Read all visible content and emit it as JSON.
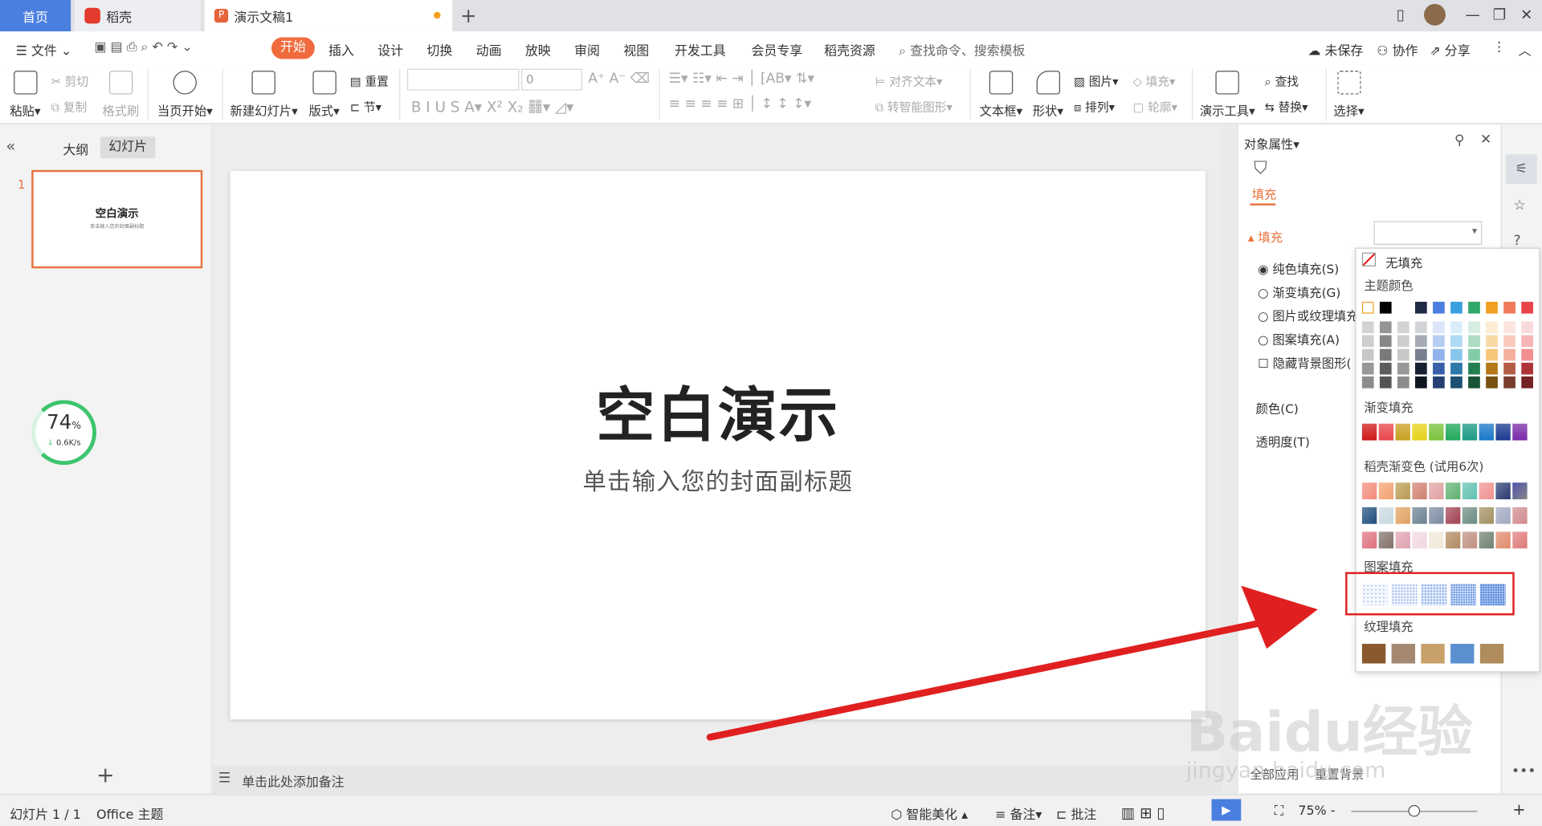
{
  "tabs": {
    "home": "首页",
    "daoke": "稻壳",
    "doc": "演示文稿1"
  },
  "menu": {
    "file": "文件",
    "start": "开始",
    "insert": "插入",
    "design": "设计",
    "switch": "切换",
    "animation": "动画",
    "play": "放映",
    "review": "审阅",
    "view": "视图",
    "dev": "开发工具",
    "vip": "会员专享",
    "resources": "稻壳资源",
    "search": "查找命令、搜索模板",
    "unsaved": "未保存",
    "collab": "协作",
    "share": "分享"
  },
  "ribbon": {
    "paste": "粘贴",
    "cut": "剪切",
    "copy": "复制",
    "format_brush": "格式刷",
    "from_current": "当页开始",
    "new_slide": "新建幻灯片",
    "layout": "版式",
    "section": "节",
    "reset": "重置",
    "font_size": "0",
    "align_text": "对齐文本",
    "smartart": "转智能图形",
    "textbox": "文本框",
    "shape": "形状",
    "picture": "图片",
    "arrange": "排列",
    "fill": "填充",
    "outline": "轮廓",
    "present_tool": "演示工具",
    "find": "查找",
    "replace": "替换",
    "select": "选择"
  },
  "left": {
    "outline_tab": "大纲",
    "slides_tab": "幻灯片",
    "slide_number": "1",
    "thumb_title": "空白演示",
    "thumb_sub": "单击输入您的封面副标题",
    "progress_value": "74",
    "progress_unit": "%",
    "net_speed": "0.6K/s"
  },
  "slide": {
    "title": "空白演示",
    "subtitle": "单击输入您的封面副标题"
  },
  "notes": {
    "placeholder": "单击此处添加备注"
  },
  "panel": {
    "title": "对象属性",
    "fill_tab": "填充",
    "fill_section": "填充",
    "opt_solid": "纯色填充(S)",
    "opt_gradient": "渐变填充(G)",
    "opt_picture": "图片或纹理填充",
    "opt_pattern": "图案填充(A)",
    "opt_hide_bg": "隐藏背景图形(",
    "color_label": "颜色(C)",
    "transparency_label": "透明度(T)",
    "apply_all": "全部应用",
    "reset_bg": "重置背景"
  },
  "popup": {
    "no_fill": "无填充",
    "theme_colors": "主题颜色",
    "gradient": "渐变填充",
    "daoke_gradient": "稻壳渐变色 (试用6次)",
    "pattern": "图案填充",
    "texture": "纹理填充"
  },
  "status": {
    "slide_info": "幻灯片 1 / 1",
    "theme": "Office 主题",
    "beautify": "智能美化",
    "notes": "备注",
    "comments": "批注",
    "zoom": "75%"
  },
  "watermark": {
    "brand": "Baidu经验",
    "url": "jingyan.baidu.com"
  },
  "colors": {
    "accent": "#f06b3d",
    "tab_active": "#4a7fe0",
    "thumb_border": "#e8733e",
    "annotation_red": "#e02020"
  }
}
